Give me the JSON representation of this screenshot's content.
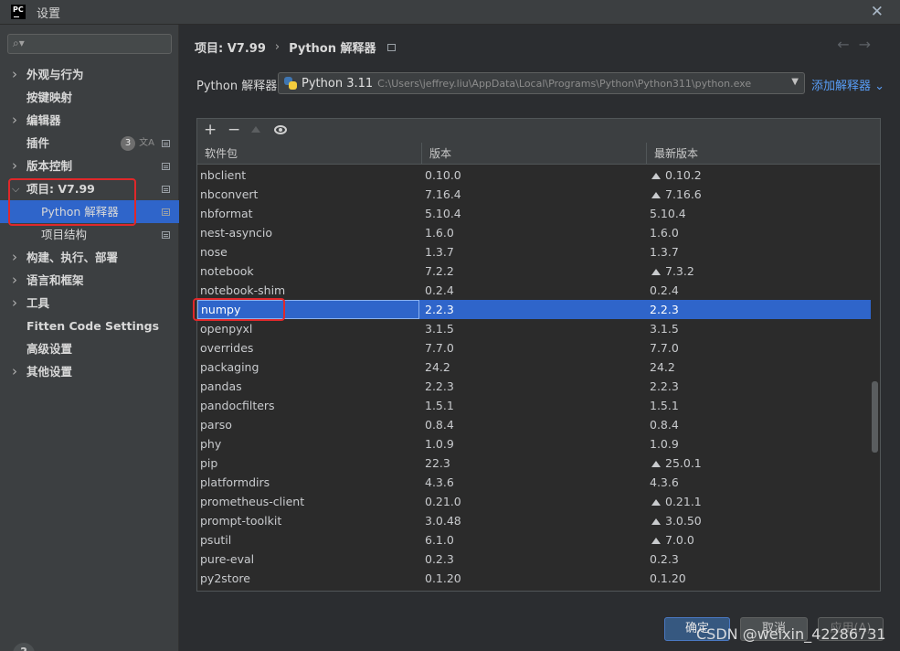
{
  "window": {
    "title": "设置",
    "logo_text": "PC"
  },
  "search": {
    "placeholder": ""
  },
  "sidebar": {
    "items": [
      {
        "label": "外观与行为",
        "expandable": true
      },
      {
        "label": "按键映射",
        "expandable": false
      },
      {
        "label": "编辑器",
        "expandable": true
      },
      {
        "label": "插件",
        "expandable": false,
        "badge": "3"
      },
      {
        "label": "版本控制",
        "expandable": true
      },
      {
        "label": "项目: V7.99",
        "expandable": true,
        "expanded": true
      },
      {
        "label": "Python 解释器",
        "child": true,
        "selected": true
      },
      {
        "label": "项目结构",
        "child": true
      },
      {
        "label": "构建、执行、部署",
        "expandable": true
      },
      {
        "label": "语言和框架",
        "expandable": true
      },
      {
        "label": "工具",
        "expandable": true
      },
      {
        "label": "Fitten Code Settings",
        "expandable": false
      },
      {
        "label": "高级设置",
        "expandable": false
      },
      {
        "label": "其他设置",
        "expandable": true
      }
    ]
  },
  "breadcrumb": {
    "project": "项目: V7.99",
    "separator": "›",
    "page": "Python 解释器"
  },
  "interpreter": {
    "label": "Python 解释器:",
    "name": "Python 3.11",
    "path": "C:\\Users\\jeffrey.liu\\AppData\\Local\\Programs\\Python\\Python311\\python.exe",
    "add_link": "添加解释器"
  },
  "toolbar": {
    "add": "+",
    "remove": "−"
  },
  "table": {
    "headers": [
      "软件包",
      "版本",
      "最新版本"
    ],
    "rows": [
      {
        "name": "nbclient",
        "version": "0.10.0",
        "latest": "0.10.2",
        "upgrade": true
      },
      {
        "name": "nbconvert",
        "version": "7.16.4",
        "latest": "7.16.6",
        "upgrade": true
      },
      {
        "name": "nbformat",
        "version": "5.10.4",
        "latest": "5.10.4",
        "upgrade": false
      },
      {
        "name": "nest-asyncio",
        "version": "1.6.0",
        "latest": "1.6.0",
        "upgrade": false
      },
      {
        "name": "nose",
        "version": "1.3.7",
        "latest": "1.3.7",
        "upgrade": false
      },
      {
        "name": "notebook",
        "version": "7.2.2",
        "latest": "7.3.2",
        "upgrade": true
      },
      {
        "name": "notebook-shim",
        "version": "0.2.4",
        "latest": "0.2.4",
        "upgrade": false
      },
      {
        "name": "numpy",
        "version": "2.2.3",
        "latest": "2.2.3",
        "upgrade": false,
        "selected": true
      },
      {
        "name": "openpyxl",
        "version": "3.1.5",
        "latest": "3.1.5",
        "upgrade": false
      },
      {
        "name": "overrides",
        "version": "7.7.0",
        "latest": "7.7.0",
        "upgrade": false
      },
      {
        "name": "packaging",
        "version": "24.2",
        "latest": "24.2",
        "upgrade": false
      },
      {
        "name": "pandas",
        "version": "2.2.3",
        "latest": "2.2.3",
        "upgrade": false
      },
      {
        "name": "pandocfilters",
        "version": "1.5.1",
        "latest": "1.5.1",
        "upgrade": false
      },
      {
        "name": "parso",
        "version": "0.8.4",
        "latest": "0.8.4",
        "upgrade": false
      },
      {
        "name": "phy",
        "version": "1.0.9",
        "latest": "1.0.9",
        "upgrade": false
      },
      {
        "name": "pip",
        "version": "22.3",
        "latest": "25.0.1",
        "upgrade": true
      },
      {
        "name": "platformdirs",
        "version": "4.3.6",
        "latest": "4.3.6",
        "upgrade": false
      },
      {
        "name": "prometheus-client",
        "version": "0.21.0",
        "latest": "0.21.1",
        "upgrade": true
      },
      {
        "name": "prompt-toolkit",
        "version": "3.0.48",
        "latest": "3.0.50",
        "upgrade": true
      },
      {
        "name": "psutil",
        "version": "6.1.0",
        "latest": "7.0.0",
        "upgrade": true
      },
      {
        "name": "pure-eval",
        "version": "0.2.3",
        "latest": "0.2.3",
        "upgrade": false
      },
      {
        "name": "py2store",
        "version": "0.1.20",
        "latest": "0.1.20",
        "upgrade": false
      }
    ]
  },
  "buttons": {
    "ok": "确定",
    "cancel": "取消",
    "apply": "应用(A)",
    "help": "?"
  },
  "watermark": "CSDN @weixin_42286731",
  "colors": {
    "selection": "#2f65ca",
    "link": "#589df6",
    "highlight_box": "#e0282a"
  }
}
